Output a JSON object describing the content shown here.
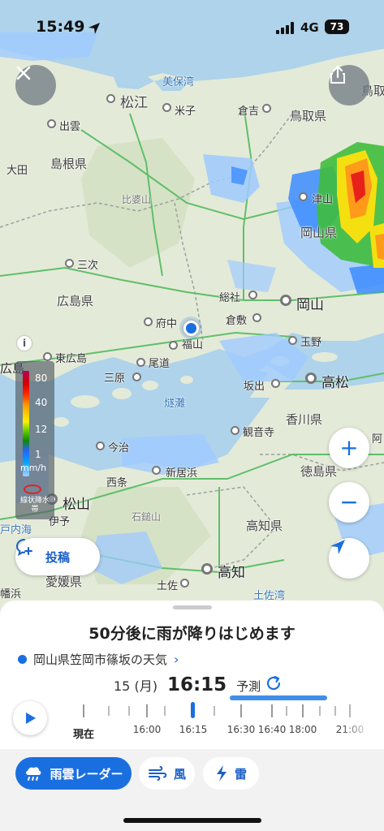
{
  "status_bar": {
    "time": "15:49",
    "network": "4G",
    "battery": "73"
  },
  "map": {
    "places": [
      {
        "name": "美保湾",
        "kind": "water"
      },
      {
        "name": "松江",
        "kind": "city"
      },
      {
        "name": "米子",
        "kind": "city"
      },
      {
        "name": "倉吉",
        "kind": "city"
      },
      {
        "name": "鳥取県",
        "kind": "pref"
      },
      {
        "name": "鳥取",
        "kind": "city"
      },
      {
        "name": "出雲",
        "kind": "city"
      },
      {
        "name": "大田",
        "kind": "city"
      },
      {
        "name": "島根県",
        "kind": "pref"
      },
      {
        "name": "比婆山",
        "kind": "mountain"
      },
      {
        "name": "津山",
        "kind": "city"
      },
      {
        "name": "岡山県",
        "kind": "pref"
      },
      {
        "name": "三次",
        "kind": "city"
      },
      {
        "name": "広島県",
        "kind": "pref"
      },
      {
        "name": "総社",
        "kind": "city"
      },
      {
        "name": "岡山",
        "kind": "bigcity"
      },
      {
        "name": "府中",
        "kind": "city"
      },
      {
        "name": "倉敷",
        "kind": "city"
      },
      {
        "name": "福山",
        "kind": "city"
      },
      {
        "name": "玉野",
        "kind": "city"
      },
      {
        "name": "広島",
        "kind": "bigcity"
      },
      {
        "name": "東広島",
        "kind": "city"
      },
      {
        "name": "尾道",
        "kind": "city"
      },
      {
        "name": "三原",
        "kind": "city"
      },
      {
        "name": "坂出",
        "kind": "city"
      },
      {
        "name": "高松",
        "kind": "bigcity"
      },
      {
        "name": "燧灘",
        "kind": "water"
      },
      {
        "name": "香川県",
        "kind": "pref"
      },
      {
        "name": "観音寺",
        "kind": "city"
      },
      {
        "name": "今治",
        "kind": "city"
      },
      {
        "name": "徳島県",
        "kind": "pref"
      },
      {
        "name": "西条",
        "kind": "city"
      },
      {
        "name": "新居浜",
        "kind": "city"
      },
      {
        "name": "松山",
        "kind": "bigcity"
      },
      {
        "name": "伊予",
        "kind": "city"
      },
      {
        "name": "石鎚山",
        "kind": "mountain"
      },
      {
        "name": "高知県",
        "kind": "pref"
      },
      {
        "name": "戸内海",
        "kind": "water"
      },
      {
        "name": "愛媛県",
        "kind": "pref"
      },
      {
        "name": "高知",
        "kind": "bigcity"
      },
      {
        "name": "土佐",
        "kind": "city"
      },
      {
        "name": "土佐湾",
        "kind": "water"
      },
      {
        "name": "幡浜",
        "kind": "city"
      },
      {
        "name": "阿",
        "kind": "city"
      }
    ],
    "legend": {
      "values": [
        "80",
        "40",
        "12",
        "1"
      ],
      "unit": "mm/h",
      "band_label": "線状降水帯"
    },
    "info_icon": "i",
    "post_button": {
      "label": "投稿",
      "icon": "chat-plus-icon"
    },
    "controls": {
      "zoom_in": "+",
      "zoom_out": "−"
    }
  },
  "sheet": {
    "headline": "50分後に雨が降りはじめます",
    "location": "岡山県笠岡市篠坂の天気",
    "date": "15 (月)",
    "time": "16:15",
    "forecast_label": "予測",
    "timeline": {
      "labels": [
        "現在",
        "16:00",
        "16:15",
        "16:30",
        "16:40",
        "18:00",
        "21:00"
      ],
      "current": "16:15"
    }
  },
  "tabs": [
    {
      "label": "雨雲レーダー",
      "icon": "rain-cloud-icon",
      "active": true
    },
    {
      "label": "風",
      "icon": "wind-icon",
      "active": false
    },
    {
      "label": "雷",
      "icon": "lightning-icon",
      "active": false
    }
  ],
  "colors": {
    "accent": "#1a6fe0",
    "sea": "#aed3ea",
    "land": "#e4ead8",
    "location_dot": "#1a6fe0"
  }
}
